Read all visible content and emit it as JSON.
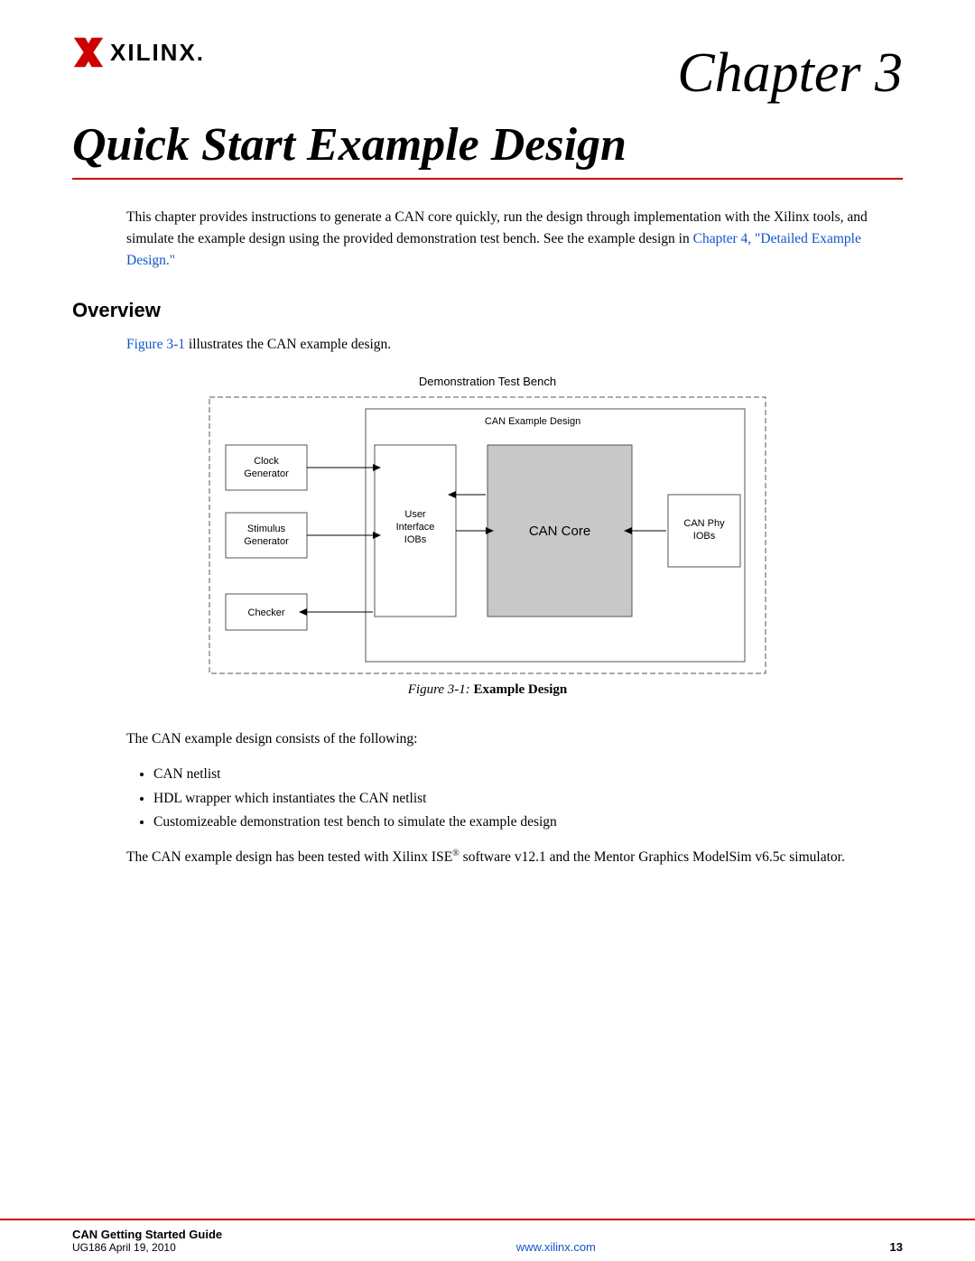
{
  "header": {
    "logo_text": "XILINX.",
    "chapter_label": "Chapter 3"
  },
  "title": {
    "text": "Quick Start Example Design"
  },
  "intro": {
    "paragraph": "This chapter provides instructions to generate a CAN core quickly, run the design through implementation with the Xilinx tools, and simulate the example design using the provided demonstration test bench. See the example design in",
    "link_text": "Chapter 4, \"Detailed Example Design.\""
  },
  "overview": {
    "heading": "Overview",
    "figure_ref_text": "Figure 3-1",
    "figure_ref_suffix": " illustrates the CAN example design."
  },
  "diagram": {
    "top_label": "Demonstration Test Bench",
    "can_example_label": "CAN Example Design",
    "clock_gen": "Clock\nGenerator",
    "stimulus_gen": "Stimulus\nGenerator",
    "checker": "Checker",
    "user_iobs": "User\nInterface\nIOBs",
    "can_core": "CAN Core",
    "can_phy": "CAN Phy\nIOBs",
    "caption_italic": "Figure 3-1:",
    "caption_bold": "  Example Design"
  },
  "body": {
    "consists_text": "The CAN example design consists of the following:",
    "bullet1": "CAN netlist",
    "bullet2": "HDL wrapper which instantiates the CAN netlist",
    "bullet3": "Customizeable demonstration test bench to simulate the example design",
    "tested_text": "The CAN example design has been tested with Xilinx ISE",
    "tested_suffix": " software v12.1 and the Mentor Graphics ModelSim v6.5c simulator."
  },
  "footer": {
    "title": "CAN Getting Started Guide",
    "subtitle": "UG186 April 19, 2010",
    "website": "www.xilinx.com",
    "page_number": "13"
  }
}
